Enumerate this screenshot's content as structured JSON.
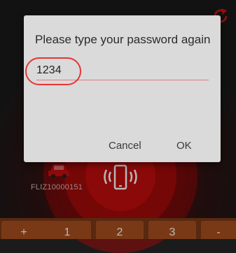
{
  "dialog": {
    "title": "Please type your password again",
    "password_value": "1234",
    "cancel_label": "Cancel",
    "ok_label": "OK"
  },
  "vehicle": {
    "id": "FLIZ10000151"
  },
  "keypad": {
    "keys": [
      "+",
      "1",
      "2",
      "3",
      "-"
    ]
  },
  "colors": {
    "accent_red": "#c10d0d",
    "keypad_orange": "#a9501f",
    "dialog_bg": "#dadada",
    "input_underline": "#e47b7b"
  },
  "icons": {
    "refresh": "refresh-icon",
    "car": "car-icon",
    "phone": "phone-vibrate-icon"
  }
}
